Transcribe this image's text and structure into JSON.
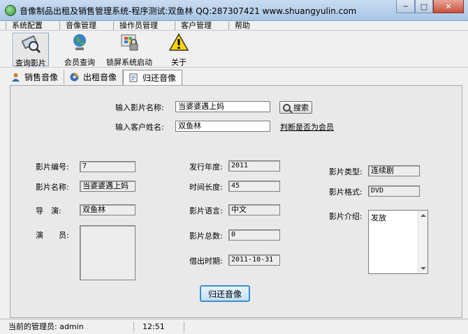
{
  "window": {
    "title": "音像制品出租及销售管理系统-程序测试:双鱼林 QQ:287307421 www.shuangyulin.com",
    "min_glyph": "─",
    "max_glyph": "□",
    "close_glyph": "✕"
  },
  "menu": [
    "系统配置",
    "音像管理",
    "操作员管理",
    "客户管理",
    "帮助"
  ],
  "toolbar": [
    {
      "label": "查询影片",
      "icon": "film-search-icon"
    },
    {
      "label": "会员查询",
      "icon": "globe-member-icon"
    },
    {
      "label": "锁屏系统启动",
      "icon": "windows-lock-icon"
    },
    {
      "label": "关于",
      "icon": "warning-icon"
    }
  ],
  "tabs": [
    {
      "label": "销售音像",
      "active": false
    },
    {
      "label": "出租音像",
      "active": false
    },
    {
      "label": "归还音像",
      "active": true
    }
  ],
  "form": {
    "film_name_label": "输入影片名称:",
    "film_name_value": "当婆婆遇上妈",
    "search_button": "搜索",
    "customer_label": "输入客户姓名:",
    "customer_value": "双鱼林",
    "check_member_link": "判断是否为会员"
  },
  "details": {
    "film_id_label": "影片编号:",
    "film_id": "7",
    "film_name_label": "影片名称:",
    "film_name": "当婆婆遇上妈",
    "director_label": "导　演:",
    "director": "双鱼林",
    "actors_label": "演　　员:",
    "actors": "",
    "year_label": "发行年度:",
    "year": "2011",
    "length_label": "时间长度:",
    "length": "45",
    "language_label": "影片语言:",
    "language": "中文",
    "total_label": "影片总数:",
    "total": "0",
    "rent_date_label": "借出时期:",
    "rent_date": "2011-10-31",
    "type_label": "影片类型:",
    "type": "连续剧",
    "format_label": "影片格式:",
    "format": "DVD",
    "intro_label": "影片介绍:",
    "intro": "发放"
  },
  "return_button": "归还音像",
  "status": {
    "admin_label": "当前的管理员: admin",
    "time": "12:51"
  }
}
